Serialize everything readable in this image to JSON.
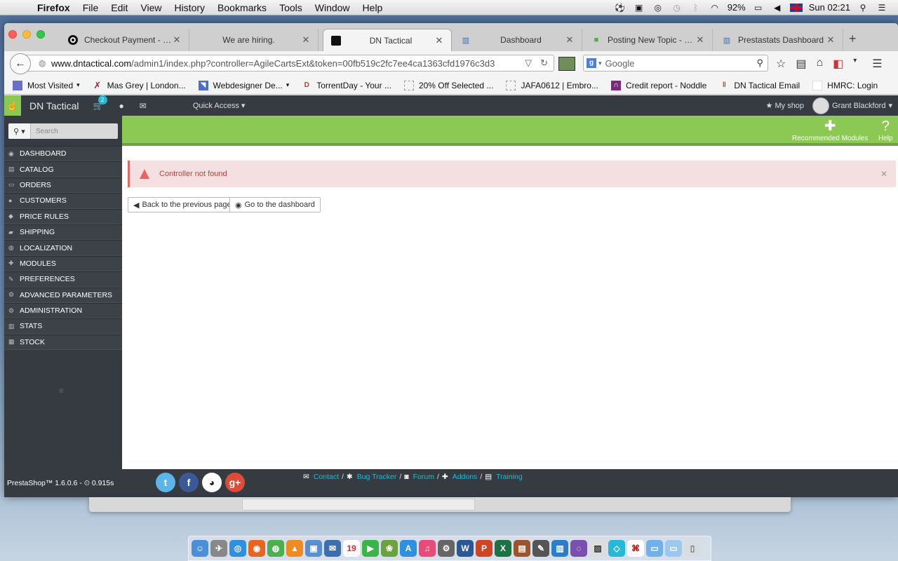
{
  "menubar": {
    "app": "Firefox",
    "items": [
      "File",
      "Edit",
      "View",
      "History",
      "Bookmarks",
      "Tools",
      "Window",
      "Help"
    ],
    "battery": "92%",
    "clock": "Sun 02:21"
  },
  "tabs": [
    {
      "title": "Checkout Payment - St...",
      "icon": "circle-logo-icon"
    },
    {
      "title": "We are hiring.",
      "icon": ""
    },
    {
      "title": "DN Tactical",
      "icon": "dn-logo-icon"
    },
    {
      "title": "Dashboard",
      "icon": "stats-icon"
    },
    {
      "title": "Posting New Topic - Pr...",
      "icon": "puzzle-icon"
    },
    {
      "title": "Prestastats Dashboard",
      "icon": "stats-icon"
    }
  ],
  "url": {
    "host": "www.dntactical.com",
    "path": "/admin1/index.php?controller=AgileCartsExt&token=00fb519c2fc7ee4ca1363cfd1976c3d3"
  },
  "search_placeholder": "Google",
  "bookmarks": [
    {
      "label": "Most Visited",
      "color": "#6a6fc9"
    },
    {
      "label": "Mas Grey | London...",
      "color": "#b02030"
    },
    {
      "label": "Webdesigner De...",
      "color": "#4a6fc9"
    },
    {
      "label": "TorrentDay - Your ...",
      "color": "#cc3333"
    },
    {
      "label": "20% Off Selected ...",
      "color": "#ffffff"
    },
    {
      "label": "JAFA0612 | Embro...",
      "color": "#ffffff"
    },
    {
      "label": "Credit report - Noddle",
      "color": "#7a2a7a"
    },
    {
      "label": "DN Tactical Email",
      "color": "#d32f2f"
    },
    {
      "label": "HMRC: Login",
      "color": "#ffffff"
    }
  ],
  "ps": {
    "shop_name": "DN Tactical",
    "cart_count": "2",
    "quick_access": "Quick Access",
    "my_shop": "My shop",
    "user": "Grant Blackford",
    "search_placeholder": "Search",
    "menu": [
      "DASHBOARD",
      "CATALOG",
      "ORDERS",
      "CUSTOMERS",
      "PRICE RULES",
      "SHIPPING",
      "LOCALIZATION",
      "MODULES",
      "PREFERENCES",
      "ADVANCED PARAMETERS",
      "ADMINISTRATION",
      "STATS",
      "STOCK"
    ],
    "toolbar": {
      "recommended": "Recommended Modules",
      "help": "Help"
    },
    "alert": "Controller not found",
    "back_btn": "Back to the previous page",
    "dash_btn": "Go to the dashboard",
    "version": "PrestaShop™ 1.6.0.6 - ⏲ 0.915s",
    "footer_links": [
      "Contact",
      "Bug Tracker",
      "Forum",
      "Addons",
      "Training"
    ]
  },
  "colors": {
    "green": "#8bc954",
    "dark": "#363a41",
    "alert": "#f4e0e0",
    "link": "#25b9d7"
  }
}
